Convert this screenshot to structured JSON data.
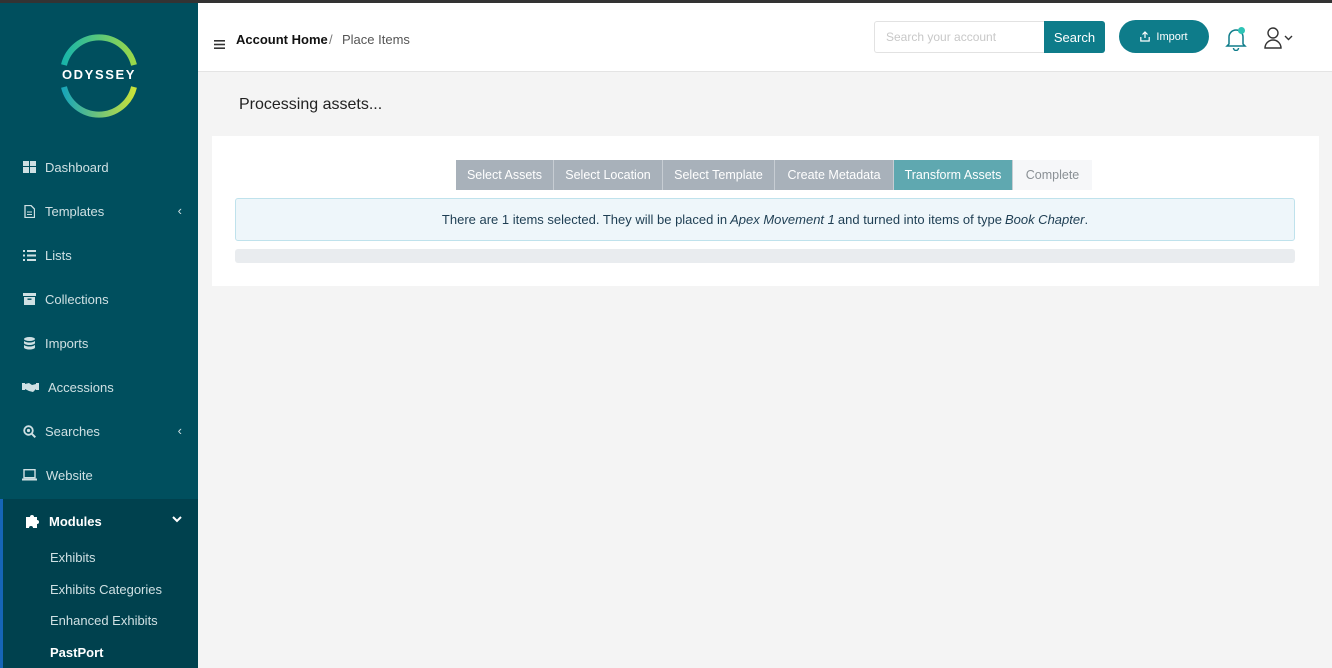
{
  "app": {
    "logo_text": "ODYSSEY"
  },
  "sidebar": {
    "items": [
      {
        "label": "Dashboard",
        "icon": "dashboard-icon"
      },
      {
        "label": "Templates",
        "icon": "document-icon",
        "has_submenu": true
      },
      {
        "label": "Lists",
        "icon": "list-icon"
      },
      {
        "label": "Collections",
        "icon": "archive-icon"
      },
      {
        "label": "Imports",
        "icon": "database-icon"
      },
      {
        "label": "Accessions",
        "icon": "handshake-icon"
      },
      {
        "label": "Searches",
        "icon": "search-icon",
        "has_submenu": true
      },
      {
        "label": "Website",
        "icon": "laptop-icon"
      },
      {
        "label": "Modules",
        "icon": "puzzle-icon",
        "expanded": true
      }
    ],
    "sub_items": [
      {
        "label": "Exhibits"
      },
      {
        "label": "Exhibits Categories"
      },
      {
        "label": "Enhanced Exhibits"
      },
      {
        "label": "PastPort",
        "current": true
      }
    ]
  },
  "header": {
    "breadcrumb_home": "Account Home",
    "breadcrumb_separator": "/",
    "breadcrumb_current": "Place Items",
    "search_placeholder": "Search your account",
    "search_value": "",
    "search_button": "Search",
    "import_button": "Import"
  },
  "main": {
    "heading": "Processing assets...",
    "steps": [
      {
        "label": "Select Assets",
        "state": "done"
      },
      {
        "label": "Select Location",
        "state": "done"
      },
      {
        "label": "Select Template",
        "state": "done"
      },
      {
        "label": "Create Metadata",
        "state": "done"
      },
      {
        "label": "Transform Assets",
        "state": "current"
      },
      {
        "label": "Complete",
        "state": "pending"
      }
    ],
    "info": {
      "part1": "There are 1 items selected. They will be placed in",
      "location": "Apex Movement 1",
      "part2": "and turned into items of type",
      "type": "Book Chapter",
      "part3": "."
    },
    "progress_fraction": 0.0
  },
  "colors": {
    "sidebar_bg": "#004f5e",
    "accent": "#0e7c8a",
    "step_done": "#a8b1ba",
    "step_current": "#5fa8b0",
    "active_border": "#1665b8"
  }
}
